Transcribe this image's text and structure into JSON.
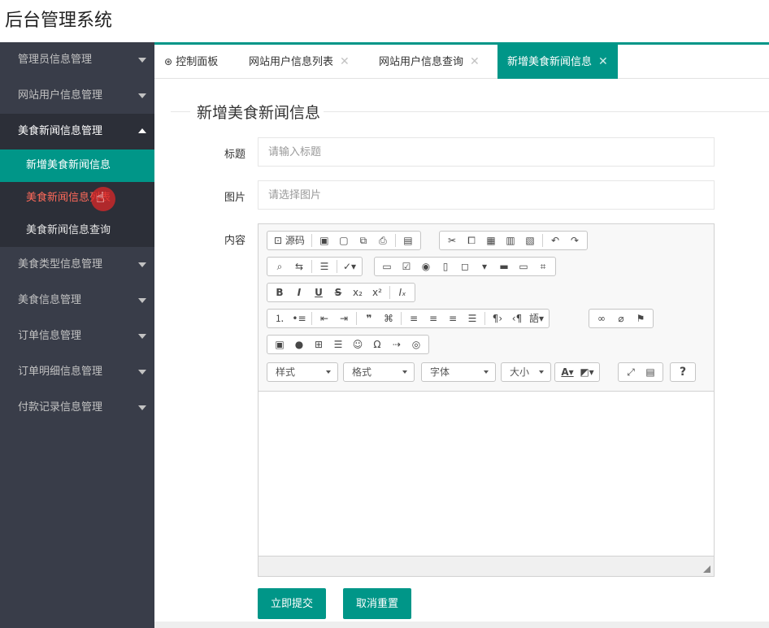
{
  "app": {
    "title": "后台管理系统"
  },
  "sidebar": {
    "menus": [
      {
        "label": "管理员信息管理"
      },
      {
        "label": "网站用户信息管理"
      },
      {
        "label": "美食新闻信息管理",
        "children": [
          "新增美食新闻信息",
          "美食新闻信息列表",
          "美食新闻信息查询"
        ]
      },
      {
        "label": "美食类型信息管理"
      },
      {
        "label": "美食信息管理"
      },
      {
        "label": "订单信息管理"
      },
      {
        "label": "订单明细信息管理"
      },
      {
        "label": "付款记录信息管理"
      }
    ],
    "accent_color": "#009688",
    "bg_color": "#393d49"
  },
  "tabs": [
    {
      "label": "控制面板",
      "icon": "dashboard-icon"
    },
    {
      "label": "网站用户信息列表"
    },
    {
      "label": "网站用户信息查询"
    },
    {
      "label": "新增美食新闻信息",
      "active": true
    }
  ],
  "form": {
    "legend": "新增美食新闻信息",
    "title_label": "标题",
    "title_placeholder": "请输入标题",
    "image_label": "图片",
    "image_placeholder": "请选择图片",
    "content_label": "内容",
    "submit_label": "立即提交",
    "reset_label": "取消重置"
  },
  "editor": {
    "source_label": "源码",
    "combos": [
      "样式",
      "格式",
      "字体",
      "大小"
    ],
    "help_label": "?"
  }
}
